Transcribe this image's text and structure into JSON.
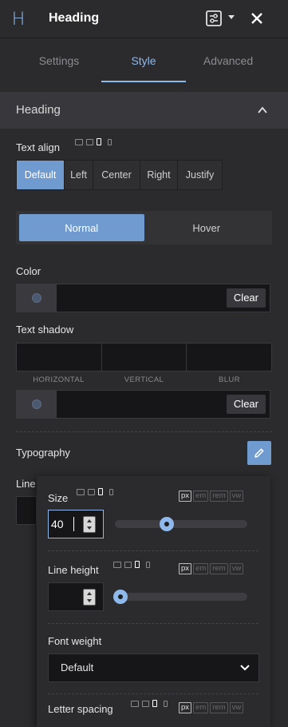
{
  "header": {
    "logo": "H",
    "title": "Heading"
  },
  "tabs": [
    {
      "label": "Settings",
      "active": false
    },
    {
      "label": "Style",
      "active": true
    },
    {
      "label": "Advanced",
      "active": false
    }
  ],
  "section": {
    "title": "Heading"
  },
  "text_align": {
    "label": "Text align",
    "options": [
      "Default",
      "Left",
      "Center",
      "Right",
      "Justify"
    ],
    "selected": "Default"
  },
  "state": {
    "normal": "Normal",
    "hover": "Hover",
    "selected": "Normal"
  },
  "color": {
    "label": "Color",
    "clear": "Clear"
  },
  "text_shadow": {
    "label": "Text shadow",
    "fields": [
      "HORIZONTAL",
      "VERTICAL",
      "BLUR"
    ],
    "clear": "Clear"
  },
  "typography": {
    "label": "Typography"
  },
  "behind": {
    "label": "Line"
  },
  "popover": {
    "size": {
      "label": "Size",
      "value": "40",
      "slider_fraction": 0.39
    },
    "line_height": {
      "label": "Line height",
      "value": "",
      "slider_fraction": 0.0
    },
    "font_weight": {
      "label": "Font weight",
      "value": "Default"
    },
    "letter_spacing": {
      "label": "Letter spacing"
    },
    "units": [
      "px",
      "em",
      "rem",
      "vw"
    ],
    "active_unit": "px"
  },
  "colors": {
    "accent": "#6f9bd1",
    "accent_light": "#8fb9ea",
    "bg": "#2b2b2e"
  }
}
